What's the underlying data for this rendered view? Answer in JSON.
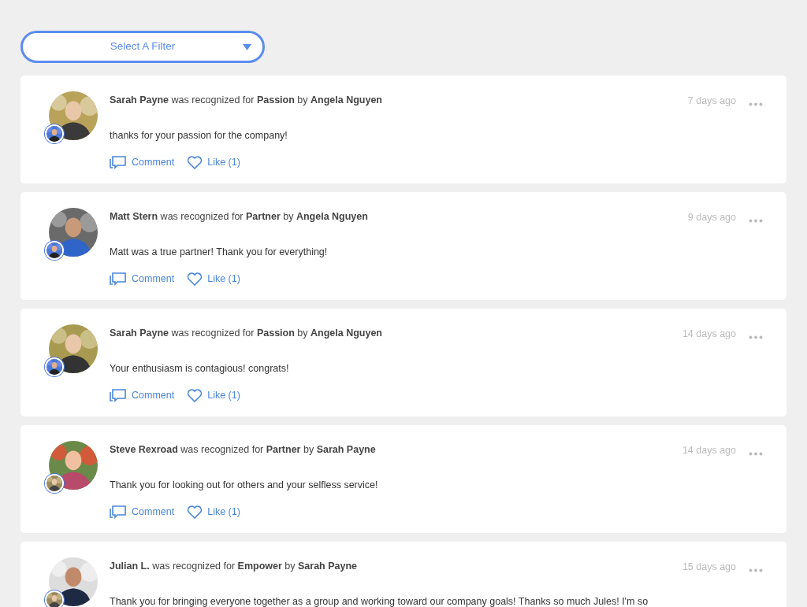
{
  "filter": {
    "label": "Select A Filter"
  },
  "posts": [
    {
      "headline": "**Sarah Payne** was recognized for **Passion** by **Angela Nguyen**",
      "time": "7 days ago",
      "message": "thanks for your passion for the company!",
      "actions": [
        {
          "kind": "comment",
          "label": "Comment"
        },
        {
          "kind": "like",
          "label": "Like (1)"
        }
      ]
    },
    {
      "headline": "**Matt Stern** was recognized for **Partner** by **Angela Nguyen**",
      "time": "9 days ago",
      "message": "Matt was a true partner! Thank you for everything!",
      "actions": [
        {
          "kind": "comment",
          "label": "Comment"
        },
        {
          "kind": "like",
          "label": "Like (1)"
        }
      ]
    },
    {
      "headline": "**Sarah Payne** was recognized for **Passion** by **Angela Nguyen**",
      "time": "14 days ago",
      "message": "Your enthusiasm is contagious! congrats!",
      "actions": [
        {
          "kind": "comment",
          "label": "Comment"
        },
        {
          "kind": "like",
          "label": "Like (1)"
        }
      ]
    },
    {
      "headline": "**Steve Rexroad** was recognized for **Partner** by **Sarah Payne**",
      "time": "14 days ago",
      "message": "Thank you for looking out for others and your selfless service!",
      "actions": [
        {
          "kind": "comment",
          "label": "Comment"
        },
        {
          "kind": "like",
          "label": "Like (1)"
        }
      ]
    },
    {
      "headline": "**Julian L.** was recognized for **Empower** by **Sarah Payne**",
      "time": "15 days ago",
      "message": "Thank you for bringing everyone together as a group and working toward our company goals! Thanks so much Jules! I'm so"
    }
  ]
}
